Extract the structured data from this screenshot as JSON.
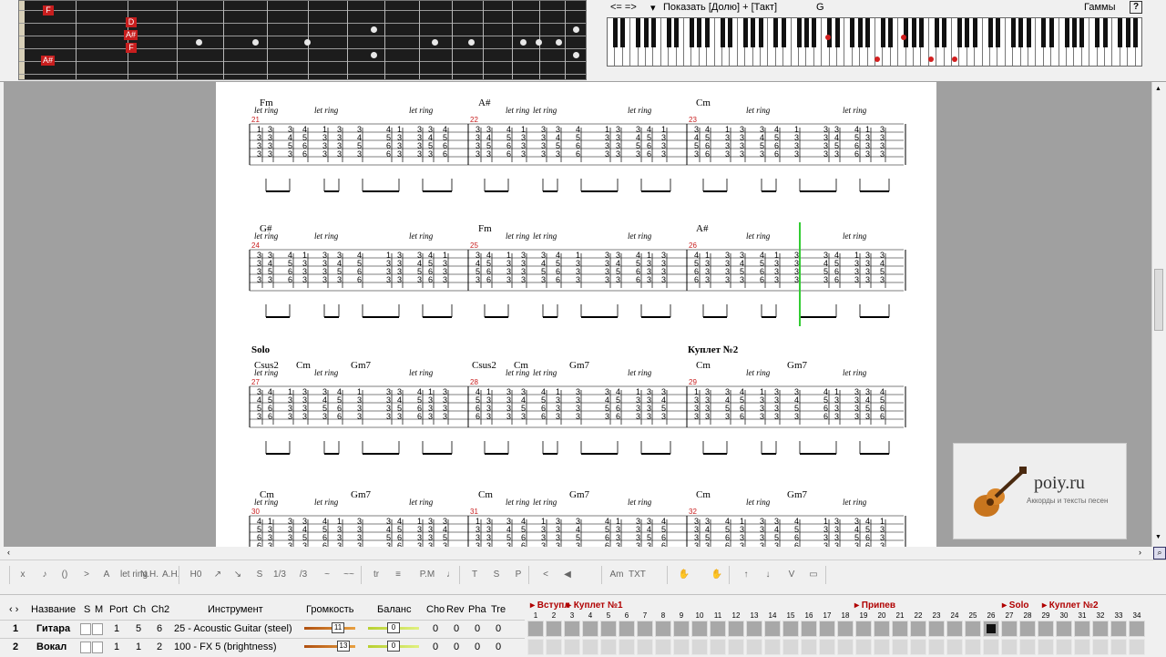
{
  "fretboard": {
    "notes": [
      "F",
      "D",
      "A#",
      "F",
      "A#"
    ]
  },
  "piano": {
    "nav": "<= =>",
    "show_label": "Показать [Долю] + [Такт]",
    "key": "G",
    "scales_label": "Гаммы",
    "help": "?"
  },
  "score": {
    "let_ring": "let ring",
    "systems": [
      {
        "measures": [
          "21",
          "22",
          "23"
        ],
        "chords": [
          "Fm",
          "A#",
          "Cm"
        ]
      },
      {
        "measures": [
          "24",
          "25",
          "26"
        ],
        "chords": [
          "G#",
          "Fm",
          "A#"
        ]
      },
      {
        "measures": [
          "27",
          "28",
          "29"
        ],
        "sections": [
          "Solo",
          "Куплет №2"
        ],
        "chords": [
          "Csus2",
          "Cm",
          "Gm7",
          "Csus2",
          "Cm",
          "Gm7",
          "Cm",
          "Gm7"
        ]
      },
      {
        "measures": [
          "30",
          "31",
          "32"
        ],
        "chords": [
          "Cm",
          "Gm7",
          "Cm",
          "Gm7",
          "Cm",
          "Gm7"
        ]
      }
    ]
  },
  "logo": {
    "site": "poiy.ru",
    "tagline": "Аккорды и тексты песен"
  },
  "toolbar": {
    "buttons": [
      "x",
      "♪",
      "()",
      ">",
      "A",
      "let ring",
      "N.H.",
      "A.H.",
      "H0",
      "↗",
      "↘",
      "S",
      "1/3",
      "/3",
      "~",
      "~~",
      "tr",
      "≡",
      "P.M",
      "♩",
      "T",
      "S",
      "P",
      "<",
      "◀",
      "Am",
      "TXT",
      "✋",
      "✋",
      "↑",
      "↓",
      "V",
      "▭"
    ]
  },
  "tracks": {
    "headers": {
      "name": "Название",
      "s": "S",
      "m": "M",
      "port": "Port",
      "ch": "Ch",
      "ch2": "Ch2",
      "instrument": "Инструмент",
      "volume": "Громкость",
      "balance": "Баланс",
      "cho": "Cho",
      "rev": "Rev",
      "pha": "Pha",
      "tre": "Tre"
    },
    "rows": [
      {
        "num": "1",
        "name": "Гитара",
        "port": "1",
        "ch": "5",
        "ch2": "6",
        "instrument": "25 - Acoustic Guitar (steel)",
        "volume": "11",
        "balance": "0",
        "cho": "0",
        "rev": "0",
        "pha": "0",
        "tre": "0"
      },
      {
        "num": "2",
        "name": "Вокал",
        "port": "1",
        "ch": "1",
        "ch2": "2",
        "instrument": "100 - FX 5 (brightness)",
        "volume": "13",
        "balance": "0",
        "cho": "0",
        "rev": "0",
        "pha": "0",
        "tre": "0"
      }
    ]
  },
  "timeline": {
    "markers": [
      "Вступл",
      "Куплет №1",
      "Припев",
      "Solo",
      "Куплет №2"
    ],
    "bars": [
      "1",
      "2",
      "3",
      "4",
      "5",
      "6",
      "7",
      "8",
      "9",
      "10",
      "11",
      "12",
      "13",
      "14",
      "15",
      "16",
      "17",
      "18",
      "19",
      "20",
      "21",
      "22",
      "23",
      "24",
      "25",
      "26",
      "27",
      "28",
      "29",
      "30",
      "31",
      "32",
      "33",
      "34"
    ]
  }
}
